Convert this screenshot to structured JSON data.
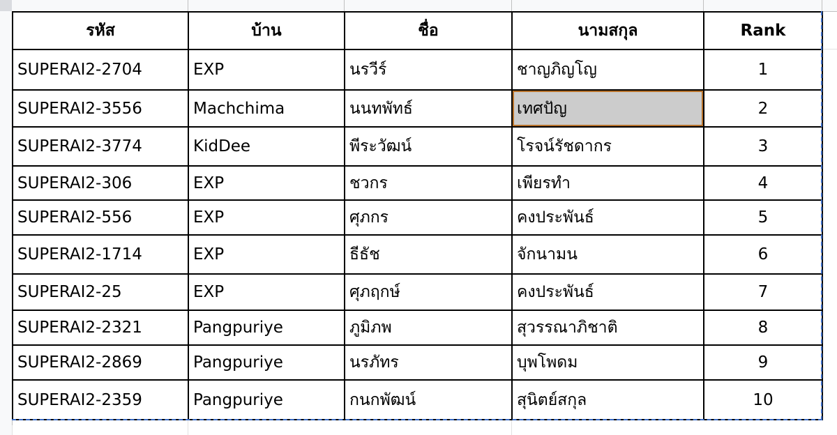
{
  "table": {
    "headers": [
      "รหัส",
      "บ้าน",
      "ชื่อ",
      "นามสกุล",
      "Rank"
    ],
    "rows": [
      [
        "SUPERAI2-2704",
        "EXP",
        "นรวีร์",
        "ชาญภิญโญ",
        "1"
      ],
      [
        "SUPERAI2-3556",
        "Machchima",
        "นนทพัทธ์",
        "เทศปัญ",
        "2"
      ],
      [
        "SUPERAI2-3774",
        "KidDee",
        "พีระวัฒน์",
        "โรจน์รัชดากร",
        "3"
      ],
      [
        "SUPERAI2-306",
        "EXP",
        "ชวกร",
        "เพียรทำ",
        "4"
      ],
      [
        "SUPERAI2-556",
        "EXP",
        "ศุภกร",
        "คงประพันธ์",
        "5"
      ],
      [
        "SUPERAI2-1714",
        "EXP",
        "ธีธัช",
        "จักนามน",
        "6"
      ],
      [
        "SUPERAI2-25",
        "EXP",
        "ศุภฤกษ์",
        "คงประพันธ์",
        "7"
      ],
      [
        "SUPERAI2-2321",
        "Pangpuriye",
        "ภูมิภพ",
        "สุวรรณาภิชาติ",
        "8"
      ],
      [
        "SUPERAI2-2869",
        "Pangpuriye",
        "นรภัทร",
        "บุพโพดม",
        "9"
      ],
      [
        "SUPERAI2-2359",
        "Pangpuriye",
        "กนกพัฒน์",
        "สุนิตย์สกุล",
        "10"
      ]
    ]
  },
  "colors": {
    "selection": "#cccccc",
    "selection_border": "#b8732b",
    "copy_marquee": "#3b6cc4"
  }
}
